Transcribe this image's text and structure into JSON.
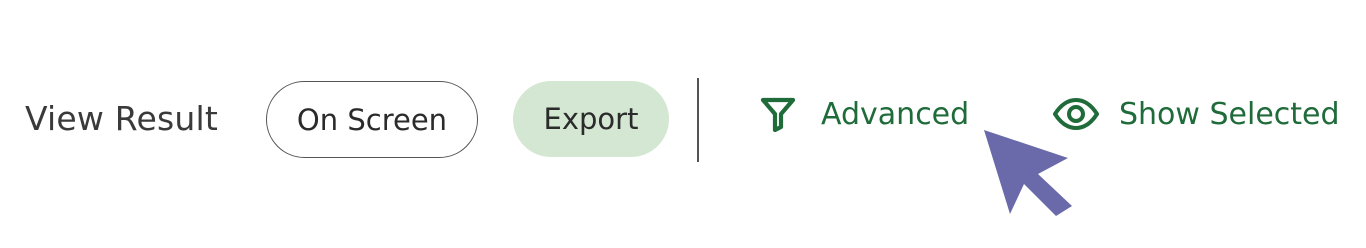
{
  "view_result": {
    "label": "View Result",
    "options": [
      {
        "label": "On Screen",
        "selected": false
      },
      {
        "label": "Export",
        "selected": true
      }
    ]
  },
  "actions": {
    "advanced": {
      "label": "Advanced",
      "icon": "filter-icon"
    },
    "show_selected": {
      "label": "Show Selected",
      "icon": "eye-icon"
    }
  },
  "colors": {
    "accent_green": "#1f6b3a",
    "selected_pill_bg": "#d4e7d2",
    "cursor": "#6a6aab"
  },
  "cursor": {
    "icon": "mouse-pointer-icon"
  }
}
